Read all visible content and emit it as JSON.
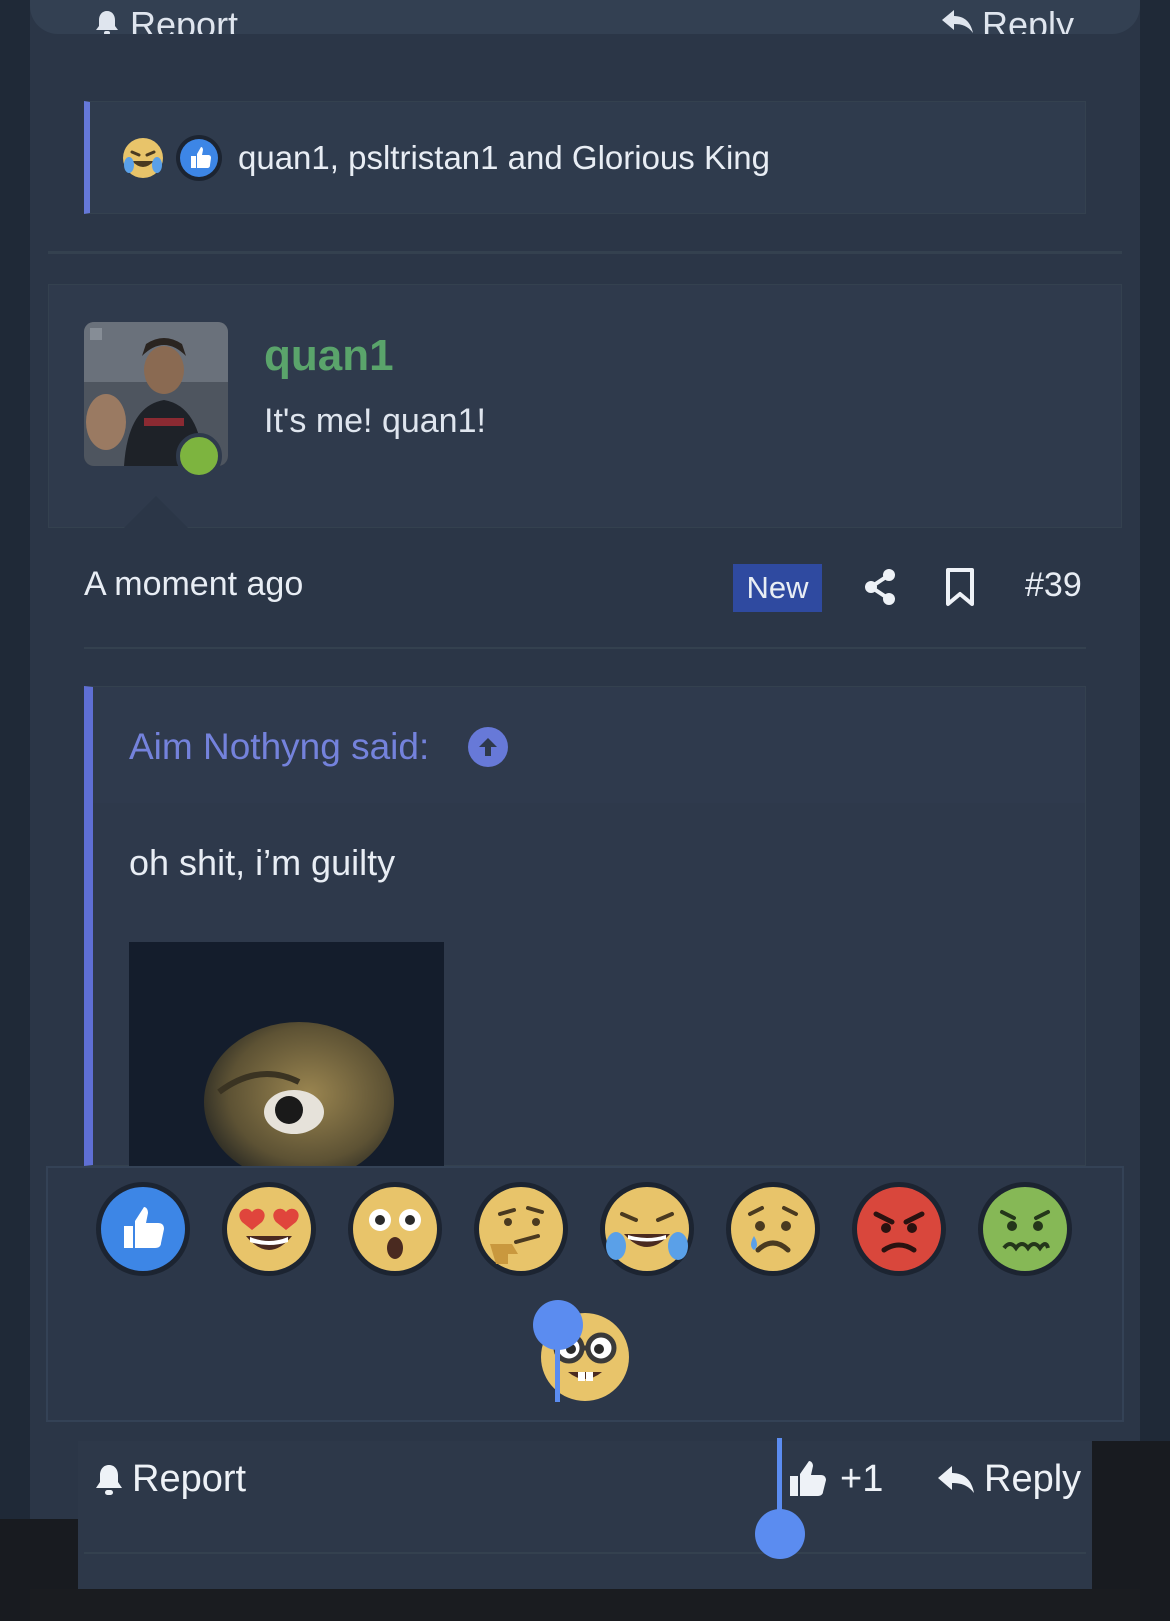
{
  "top_bar": {
    "report_label": "Report",
    "reply_label": "Reply"
  },
  "reaction_summary": {
    "emojis": [
      "laughing-crying-emoji",
      "like-emoji"
    ],
    "text": "quan1, psltristan1 and Glorious King"
  },
  "post": {
    "username": "quan1",
    "user_title": "It's me! quan1!",
    "timestamp": "A moment ago",
    "badge": "New",
    "post_number": "#39",
    "quote": {
      "author": "Aim Nothyng said:",
      "text": "oh shit, i’m guilty"
    }
  },
  "reaction_picker": {
    "options": [
      "like",
      "love",
      "wow",
      "thinking",
      "haha",
      "sad",
      "angry",
      "sick",
      "nerd"
    ]
  },
  "actions": {
    "report_label": "Report",
    "like_count": "+1",
    "reply_label": "Reply"
  },
  "colors": {
    "accent": "#6578d8",
    "username": "#5aa46b",
    "online": "#7db43f",
    "selection": "#5b8cf0",
    "badge": "#2f4aa0"
  }
}
